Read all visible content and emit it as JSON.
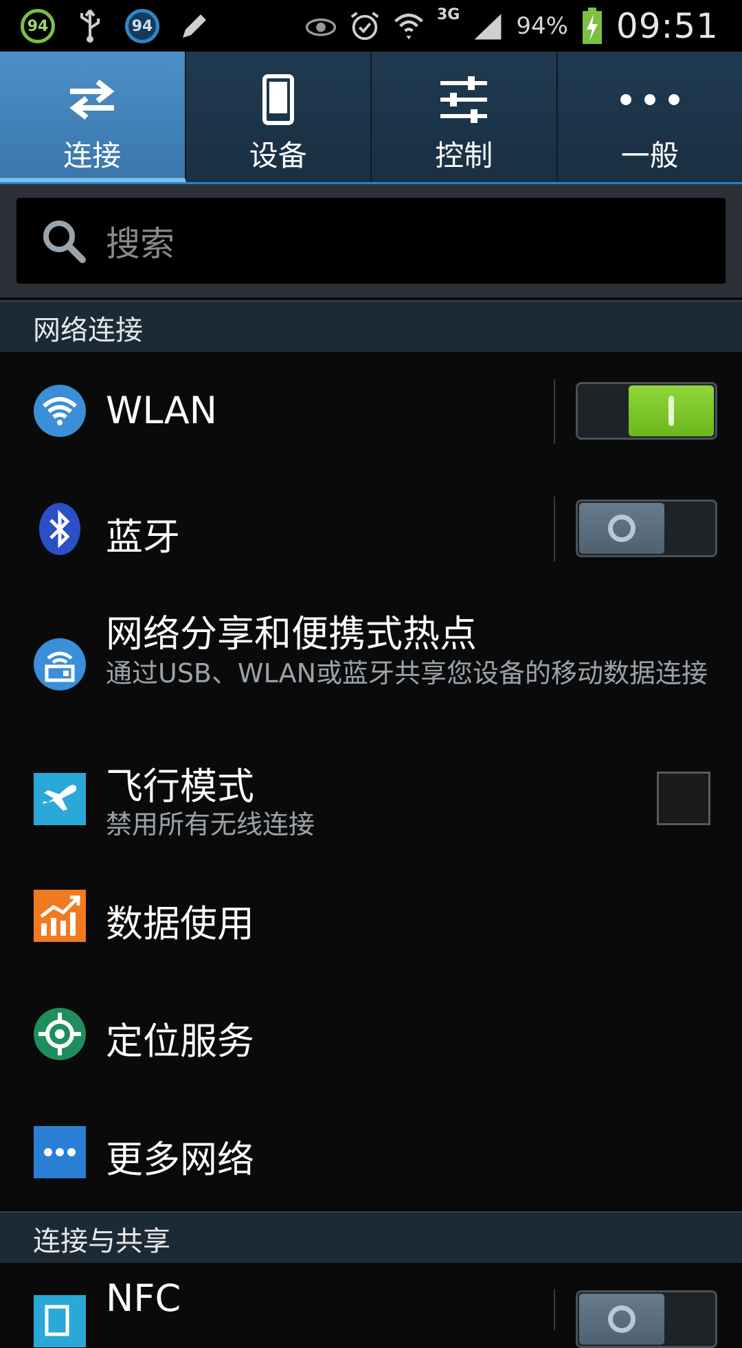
{
  "status_bar": {
    "badge1": "94",
    "badge2": "94",
    "network_type": "3G",
    "battery_percent": "94%",
    "time": "09:51"
  },
  "tabs": [
    {
      "label": "连接",
      "icon": "swap-arrows-icon",
      "active": true
    },
    {
      "label": "设备",
      "icon": "phone-device-icon",
      "active": false
    },
    {
      "label": "控制",
      "icon": "sliders-icon",
      "active": false
    },
    {
      "label": "一般",
      "icon": "more-dots-icon",
      "active": false
    }
  ],
  "search": {
    "placeholder": "搜索"
  },
  "sections": [
    {
      "header": "网络连接"
    },
    {
      "header": "连接与共享"
    }
  ],
  "items": [
    {
      "title": "WLAN",
      "icon": "wifi-icon",
      "control": "toggle",
      "state": "on"
    },
    {
      "title": "蓝牙",
      "icon": "bluetooth-icon",
      "control": "toggle",
      "state": "off"
    },
    {
      "title": "网络分享和便携式热点",
      "subtitle": "通过USB、WLAN或蓝牙共享您设备的移动数据连接",
      "icon": "hotspot-icon"
    },
    {
      "title": "飞行模式",
      "subtitle": "禁用所有无线连接",
      "icon": "airplane-icon",
      "control": "checkbox",
      "state": "unchecked"
    },
    {
      "title": "数据使用",
      "icon": "data-usage-icon"
    },
    {
      "title": "定位服务",
      "icon": "location-icon"
    },
    {
      "title": "更多网络",
      "icon": "more-networks-icon"
    },
    {
      "title": "NFC",
      "icon": "nfc-icon",
      "control": "toggle",
      "state": "off"
    }
  ],
  "colors": {
    "tab_active": "#4d8fc7",
    "toggle_on": "#7cc52b",
    "section_header": "#1c2a36"
  }
}
